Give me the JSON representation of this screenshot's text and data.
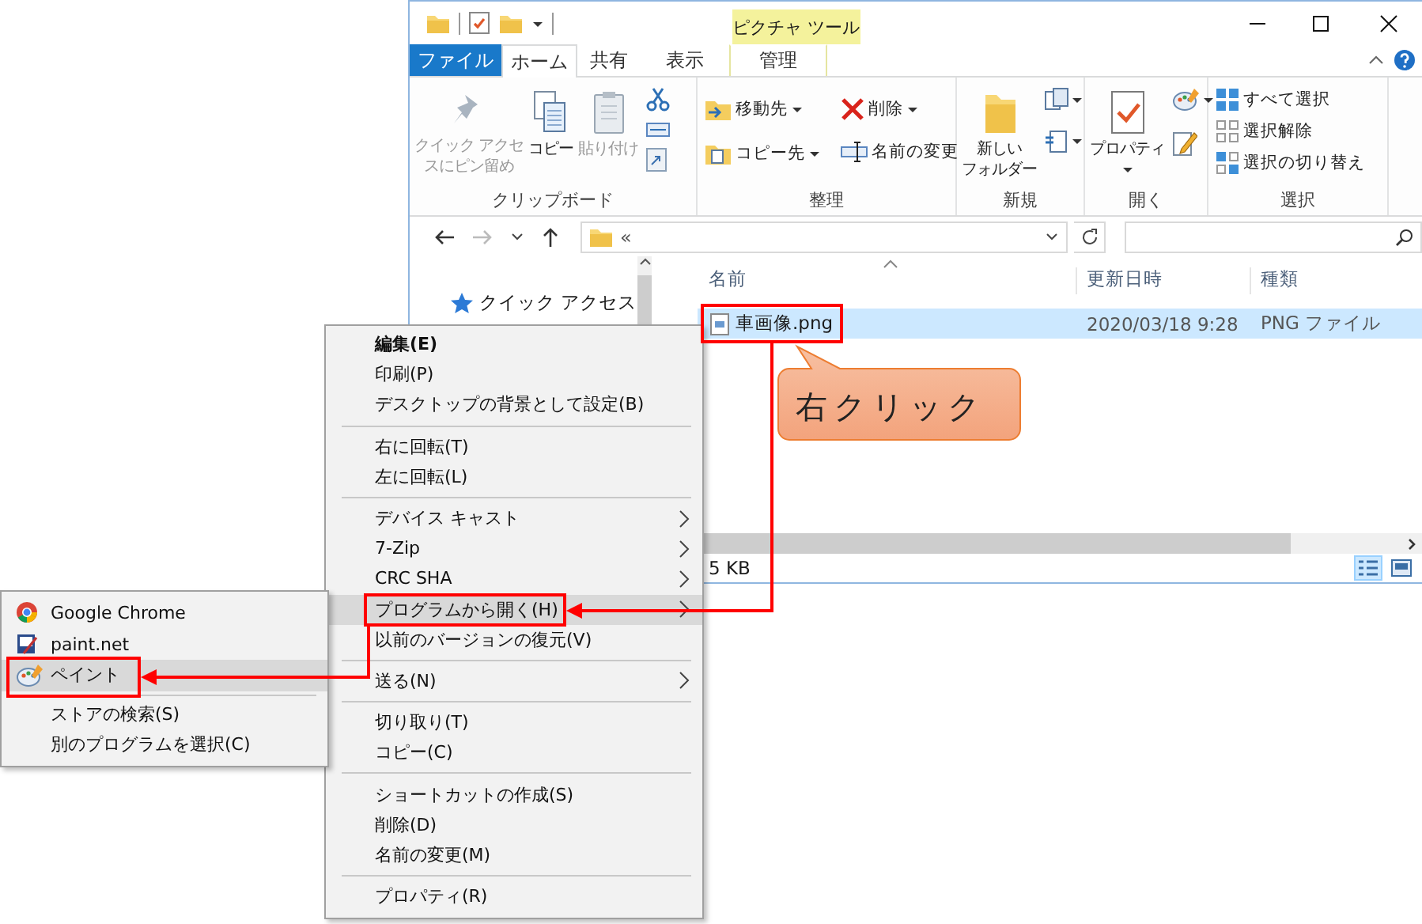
{
  "window": {
    "context_tab_header": "ピクチャ ツール"
  },
  "ribbon_tabs": [
    {
      "label": "ファイル",
      "kind": "file",
      "selected": false
    },
    {
      "label": "ホーム",
      "kind": "tab",
      "selected": true
    },
    {
      "label": "共有",
      "kind": "tab",
      "selected": false
    },
    {
      "label": "表示",
      "kind": "tab",
      "selected": false
    },
    {
      "label": "管理",
      "kind": "context",
      "selected": false
    }
  ],
  "ribbon_groups": [
    {
      "label": "クリップボード",
      "columns": [
        {
          "kind": "large",
          "lines": [
            "クイック アクセ",
            "スにピン留め"
          ],
          "disabled": true,
          "dropdown": false
        },
        {
          "kind": "large",
          "lines": [
            "コピー"
          ],
          "disabled": false,
          "dropdown": false
        },
        {
          "kind": "large",
          "lines": [
            "貼り付け"
          ],
          "disabled": true,
          "dropdown": false
        },
        {
          "kind": "icons",
          "items": [
            {
              "dropdown": false
            },
            {
              "dropdown": false
            },
            {
              "dropdown": false
            }
          ]
        }
      ]
    },
    {
      "label": "整理",
      "columns": [
        {
          "kind": "small",
          "items": [
            {
              "label": "移動先",
              "dropdown": true
            },
            {
              "label": "コピー先",
              "dropdown": true
            }
          ]
        },
        {
          "kind": "small",
          "items": [
            {
              "label": "削除",
              "dropdown": true
            },
            {
              "label": "名前の変更",
              "dropdown": false
            }
          ]
        }
      ]
    },
    {
      "label": "新規",
      "columns": [
        {
          "kind": "large",
          "lines": [
            "新しい",
            "フォルダー"
          ],
          "disabled": false,
          "dropdown": false
        },
        {
          "kind": "icons",
          "items": [
            {
              "dropdown": true
            },
            {
              "dropdown": true
            }
          ]
        }
      ]
    },
    {
      "label": "開く",
      "columns": [
        {
          "kind": "large",
          "lines": [
            "プロパティ"
          ],
          "disabled": false,
          "dropdown": true
        },
        {
          "kind": "icons",
          "items": [
            {
              "dropdown": true
            },
            {
              "dropdown": false
            }
          ]
        }
      ]
    },
    {
      "label": "選択",
      "columns": [
        {
          "kind": "small",
          "items": [
            {
              "label": "すべて選択",
              "dropdown": false
            },
            {
              "label": "選択解除",
              "dropdown": false
            },
            {
              "label": "選択の切り替え",
              "dropdown": false
            }
          ]
        }
      ]
    }
  ],
  "address_bar": {
    "path_prefix": "«"
  },
  "navigation_pane": {
    "items": [
      {
        "label": "クイック アクセス"
      }
    ]
  },
  "file_list": {
    "columns": [
      "名前",
      "更新日時",
      "種類"
    ],
    "rows": [
      {
        "name": "車画像.png",
        "modified": "2020/03/18 9:28",
        "type": "PNG ファイル",
        "selected": true
      }
    ]
  },
  "status_bar": {
    "text": "5 KB"
  },
  "view_buttons": [
    {
      "kind": "details",
      "selected": true
    },
    {
      "kind": "large_icons",
      "selected": false
    }
  ],
  "context_menu": {
    "groups": [
      [
        {
          "label": "編集(E)",
          "default": true,
          "submenu": false,
          "selected": false
        },
        {
          "label": "印刷(P)",
          "default": false,
          "submenu": false,
          "selected": false
        },
        {
          "label": "デスクトップの背景として設定(B)",
          "default": false,
          "submenu": false,
          "selected": false
        }
      ],
      [
        {
          "label": "右に回転(T)",
          "default": false,
          "submenu": false,
          "selected": false
        },
        {
          "label": "左に回転(L)",
          "default": false,
          "submenu": false,
          "selected": false
        }
      ],
      [
        {
          "label": "デバイス キャスト",
          "default": false,
          "submenu": true,
          "selected": false
        },
        {
          "label": "7-Zip",
          "default": false,
          "submenu": true,
          "selected": false
        },
        {
          "label": "CRC SHA",
          "default": false,
          "submenu": true,
          "selected": false
        },
        {
          "label": "プログラムから開く(H)",
          "default": false,
          "submenu": true,
          "selected": true
        },
        {
          "label": "以前のバージョンの復元(V)",
          "default": false,
          "submenu": false,
          "selected": false
        }
      ],
      [
        {
          "label": "送る(N)",
          "default": false,
          "submenu": true,
          "selected": false
        }
      ],
      [
        {
          "label": "切り取り(T)",
          "default": false,
          "submenu": false,
          "selected": false
        },
        {
          "label": "コピー(C)",
          "default": false,
          "submenu": false,
          "selected": false
        }
      ],
      [
        {
          "label": "ショートカットの作成(S)",
          "default": false,
          "submenu": false,
          "selected": false
        },
        {
          "label": "削除(D)",
          "default": false,
          "submenu": false,
          "selected": false
        },
        {
          "label": "名前の変更(M)",
          "default": false,
          "submenu": false,
          "selected": false
        }
      ],
      [
        {
          "label": "プロパティ(R)",
          "default": false,
          "submenu": false,
          "selected": false
        }
      ]
    ]
  },
  "open_with_submenu": {
    "groups": [
      [
        {
          "label": "Google Chrome",
          "selected": false
        },
        {
          "label": "paint.net",
          "selected": false
        },
        {
          "label": "ペイント",
          "selected": true
        }
      ],
      [
        {
          "label": "ストアの検索(S)",
          "selected": false
        },
        {
          "label": "別のプログラムを選択(C)",
          "selected": false
        }
      ]
    ]
  },
  "callout": {
    "text": "右クリック"
  }
}
